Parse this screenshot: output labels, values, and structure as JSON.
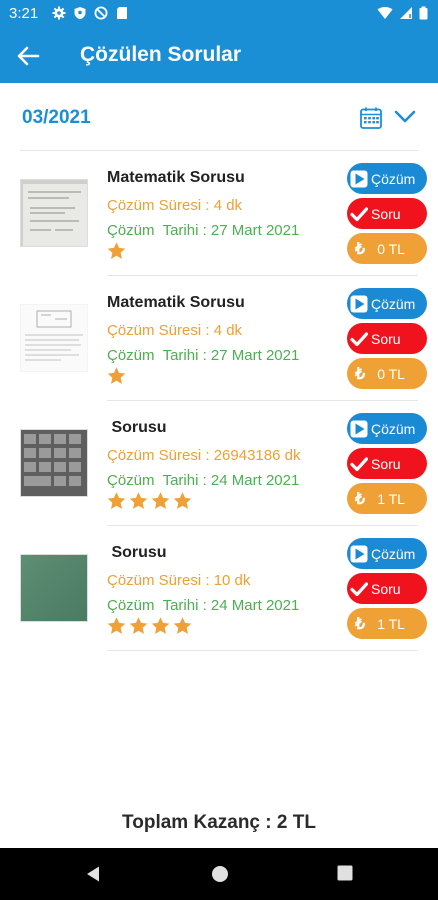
{
  "status_bar": {
    "time": "3:21",
    "left_icons": [
      "gear-icon",
      "shield-icon",
      "block-icon",
      "sd-card-icon"
    ],
    "right_icons": [
      "wifi-icon",
      "signal-icon",
      "battery-icon"
    ]
  },
  "app_bar": {
    "back_icon": "arrow-left-icon",
    "title": "Çözülen Sorular"
  },
  "filter": {
    "month": "03/2021",
    "calendar_icon": "calendar-icon",
    "dropdown_icon": "chevron-down-icon"
  },
  "items": [
    {
      "title": "Matematik Sorusu",
      "duration": "Çözüm Süresi : 4 dk",
      "date": "Çözüm  Tarihi : 27 Mart 2021",
      "rating": 1,
      "thumb": "paper-photo",
      "solution_label": "Çözüm",
      "question_label": "Soru",
      "earning_symbol": "₺",
      "earning": "0 TL"
    },
    {
      "title": "Matematik Sorusu",
      "duration": "Çözüm Süresi : 4 dk",
      "date": "Çözüm  Tarihi : 27 Mart 2021",
      "rating": 1,
      "thumb": "diagram-photo",
      "solution_label": "Çözüm",
      "question_label": "Soru",
      "earning_symbol": "₺",
      "earning": "0 TL"
    },
    {
      "title": " Sorusu",
      "duration": "Çözüm Süresi : 26943186 dk",
      "date": "Çözüm  Tarihi : 24 Mart 2021",
      "rating": 4,
      "thumb": "keyboard-photo",
      "solution_label": "Çözüm",
      "question_label": "Soru",
      "earning_symbol": "₺",
      "earning": "1 TL"
    },
    {
      "title": " Sorusu",
      "duration": "Çözüm Süresi : 10 dk",
      "date": "Çözüm  Tarihi : 24 Mart 2021",
      "rating": 4,
      "thumb": "green-photo",
      "solution_label": "Çözüm",
      "question_label": "Soru",
      "earning_symbol": "₺",
      "earning": "1 TL"
    }
  ],
  "footer": {
    "total": "Toplam Kazanç : 2 TL"
  },
  "colors": {
    "primary": "#1a8fd6",
    "danger": "#f0131e",
    "accent": "#f0a136",
    "success": "#4caf50"
  }
}
